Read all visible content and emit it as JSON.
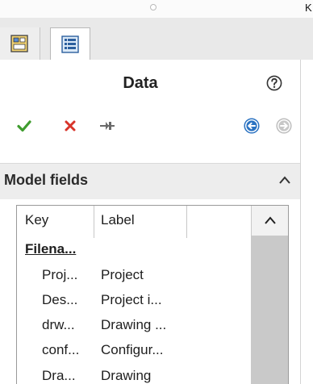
{
  "panel": {
    "title": "Data",
    "section": {
      "title": "Model fields"
    }
  },
  "grid": {
    "columns": [
      "Key",
      "Label"
    ],
    "rows": [
      {
        "key": "Filena...",
        "label": "",
        "group": true
      },
      {
        "key": "Proj...",
        "label": "Project",
        "group": false
      },
      {
        "key": "Des...",
        "label": "Project i...",
        "group": false
      },
      {
        "key": "drw...",
        "label": "Drawing ...",
        "group": false
      },
      {
        "key": "conf...",
        "label": "Configur...",
        "group": false
      },
      {
        "key": "Dra...",
        "label": "Drawing",
        "group": false
      }
    ]
  },
  "colors": {
    "confirm": "#3f9c2e",
    "cancel": "#d8342a",
    "pin": "#6a6a6a",
    "nav": "#2b73c2"
  }
}
